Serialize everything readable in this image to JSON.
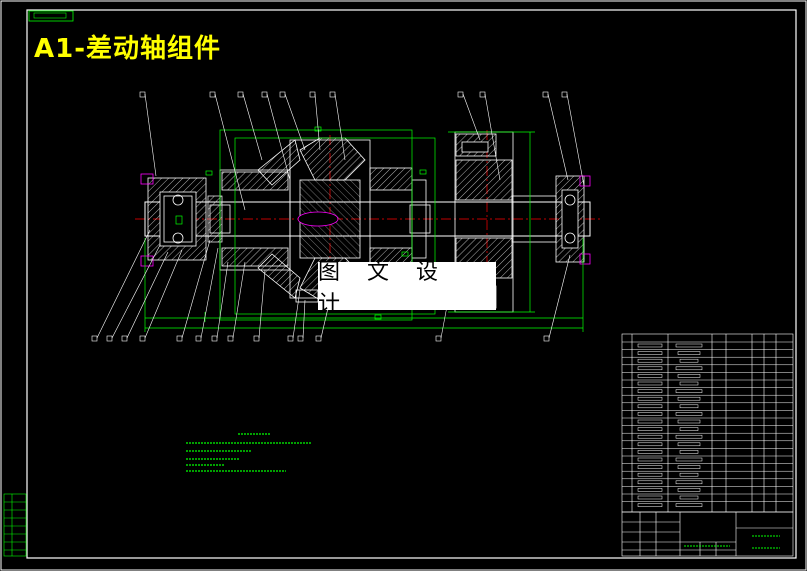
{
  "drawing": {
    "title": "A1-差动轴组件",
    "watermark": "图 文 设 计"
  },
  "colors": {
    "background": "#000000",
    "frame": "#ffffff",
    "title": "#ffff00",
    "outline": "#00ff00",
    "centerline": "#ff0000",
    "hatch": "#ffffff",
    "accent": "#ff00ff"
  },
  "icons": {
    "balloon": "part-balloon-icon",
    "titleblock": "title-block-grid"
  }
}
